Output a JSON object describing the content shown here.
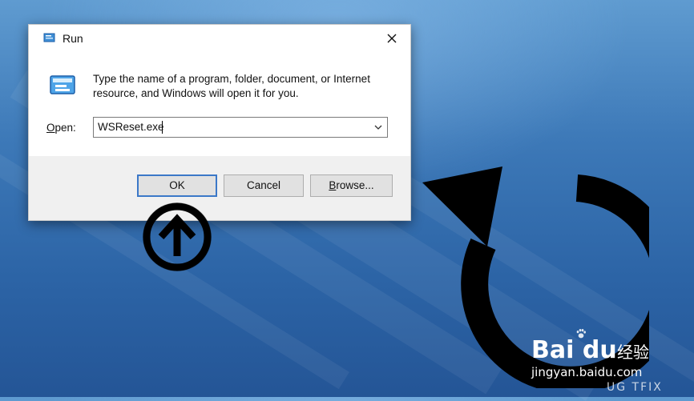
{
  "dialog": {
    "title": "Run",
    "description": "Type the name of a program, folder, document, or Internet resource, and Windows will open it for you.",
    "open_label": "Open:",
    "open_value": "WSReset.exe",
    "buttons": {
      "ok": "OK",
      "cancel": "Cancel",
      "browse": "Browse..."
    }
  },
  "icons": {
    "title": "run-icon",
    "main": "run-icon",
    "close": "close-icon",
    "dropdown": "chevron-down-icon",
    "annotation_up": "circled-up-arrow-icon",
    "annotation_refresh": "refresh-icon"
  },
  "watermark": {
    "brand": "Bai du",
    "brand_cn": "经验",
    "url": "jingyan.baidu.com",
    "site_tag": "UG TFIX"
  },
  "colors": {
    "desktop": "#2c64a6",
    "dialog_bg": "#f0f0f0",
    "ok_border": "#3b78c8",
    "annotation": "#000000"
  }
}
